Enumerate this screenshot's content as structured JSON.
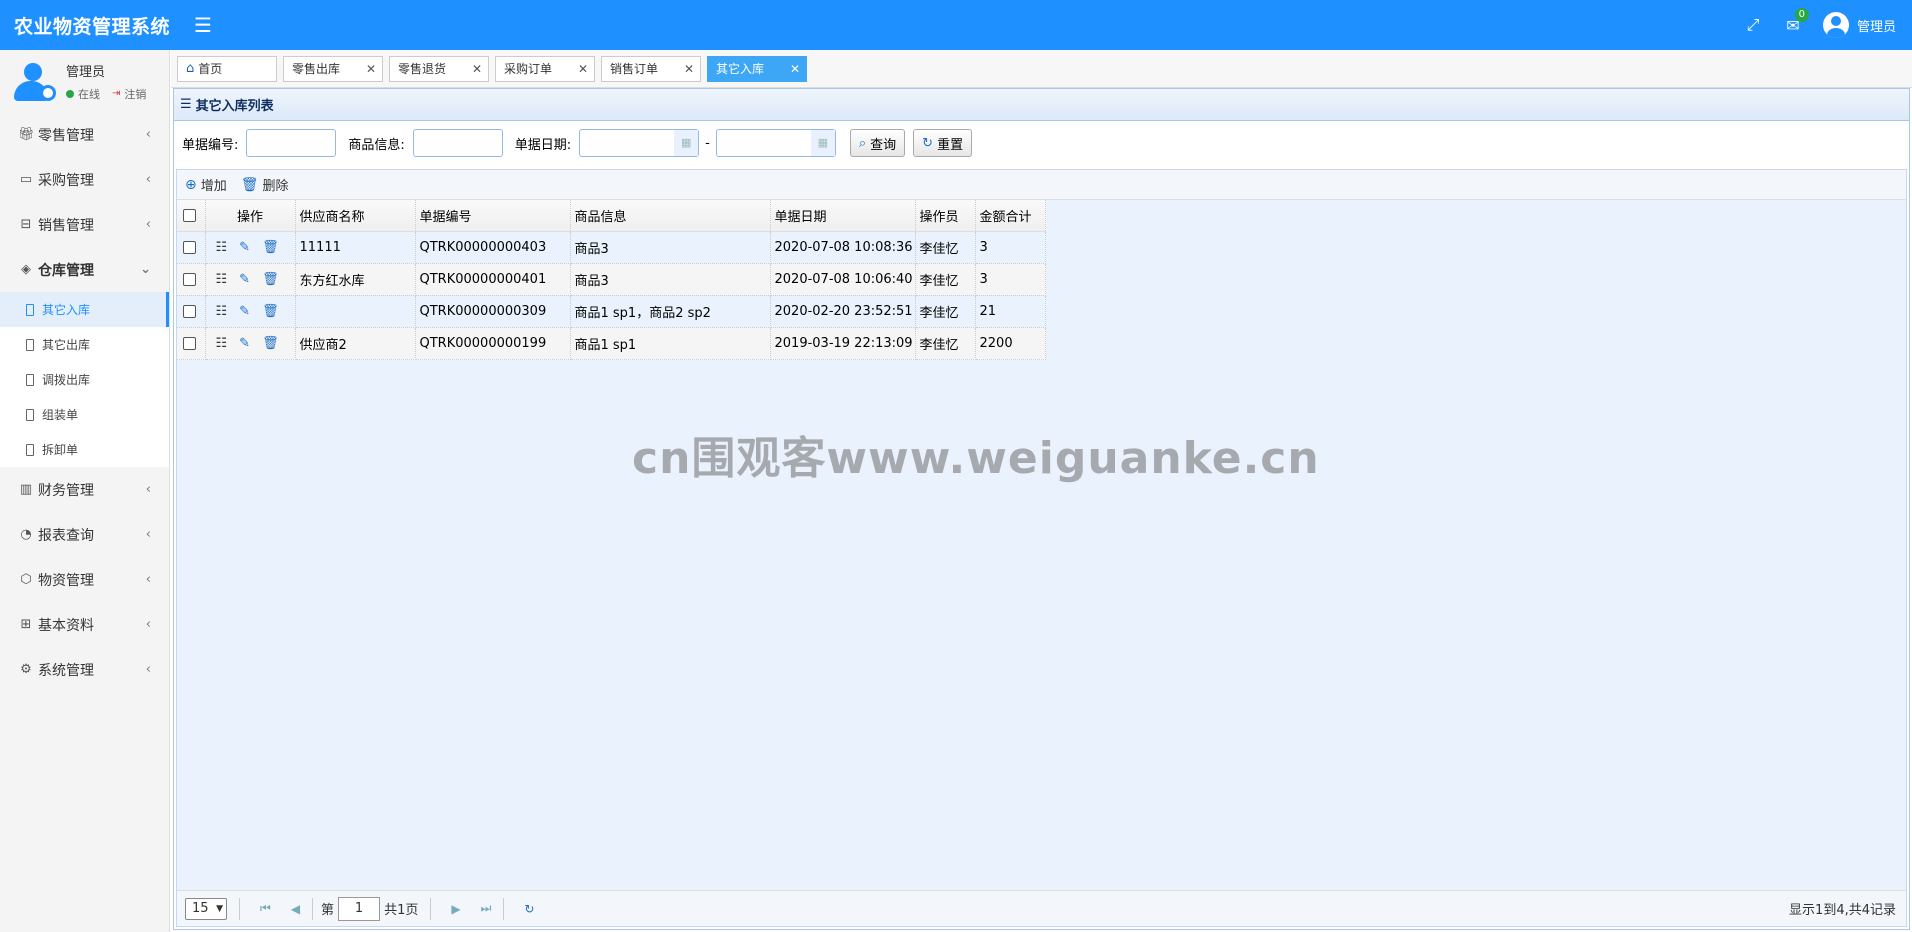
{
  "header": {
    "app_title": "农业物资管理系统",
    "menu_icon": "hamburger-icon",
    "notification_count": "0",
    "user_name": "管理员"
  },
  "user_panel": {
    "name": "管理员",
    "status": "在线",
    "logout": "注销"
  },
  "nav": {
    "items": [
      {
        "label": "零售管理",
        "icon": "gift-icon"
      },
      {
        "label": "采购管理",
        "icon": "monitor-icon"
      },
      {
        "label": "销售管理",
        "icon": "box-icon"
      },
      {
        "label": "仓库管理",
        "icon": "layers-icon"
      },
      {
        "label": "财务管理",
        "icon": "map-icon"
      },
      {
        "label": "报表查询",
        "icon": "pie-icon"
      },
      {
        "label": "物资管理",
        "icon": "cubes-icon"
      },
      {
        "label": "基本资料",
        "icon": "grid-icon"
      },
      {
        "label": "系统管理",
        "icon": "gear-icon"
      }
    ],
    "warehouse_sub": [
      "其它入库",
      "其它出库",
      "调拨出库",
      "组装单",
      "拆卸单"
    ]
  },
  "tabs": [
    {
      "label": "首页"
    },
    {
      "label": "零售出库"
    },
    {
      "label": "零售退货"
    },
    {
      "label": "采购订单"
    },
    {
      "label": "销售订单"
    },
    {
      "label": "其它入库"
    }
  ],
  "panel": {
    "title": "其它入库列表"
  },
  "search": {
    "doc_no_label": "单据编号:",
    "goods_label": "商品信息:",
    "date_label": "单据日期:",
    "date_separator": "-",
    "query_button": "查询",
    "reset_button": "重置"
  },
  "toolbar": {
    "add": "增加",
    "delete": "删除"
  },
  "table": {
    "columns": [
      "操作",
      "供应商名称",
      "单据编号",
      "商品信息",
      "单据日期",
      "操作员",
      "金额合计"
    ],
    "rows": [
      {
        "supplier": "11111",
        "doc_no": "QTRK00000000403",
        "goods": "商品3",
        "date": "2020-07-08 10:08:36",
        "operator": "李佳忆",
        "amount": "3"
      },
      {
        "supplier": "东方红水库",
        "doc_no": "QTRK00000000401",
        "goods": "商品3",
        "date": "2020-07-08 10:06:40",
        "operator": "李佳忆",
        "amount": "3"
      },
      {
        "supplier": "",
        "doc_no": "QTRK00000000309",
        "goods": "商品1 sp1，商品2 sp2",
        "date": "2020-02-20 23:52:51",
        "operator": "李佳忆",
        "amount": "21"
      },
      {
        "supplier": "供应商2",
        "doc_no": "QTRK00000000199",
        "goods": "商品1 sp1",
        "date": "2019-03-19 22:13:09",
        "operator": "李佳忆",
        "amount": "2200"
      }
    ]
  },
  "pager": {
    "page_size": "15",
    "page_prefix": "第",
    "page_number": "1",
    "page_total": "共1页",
    "summary": "显示1到4,共4记录"
  },
  "watermark": "cn围观客www.weiguanke.cn",
  "colors": {
    "header_bg": "#1e90ff",
    "active_tab": "#3da7f5",
    "accent": "#1e6fc4"
  }
}
